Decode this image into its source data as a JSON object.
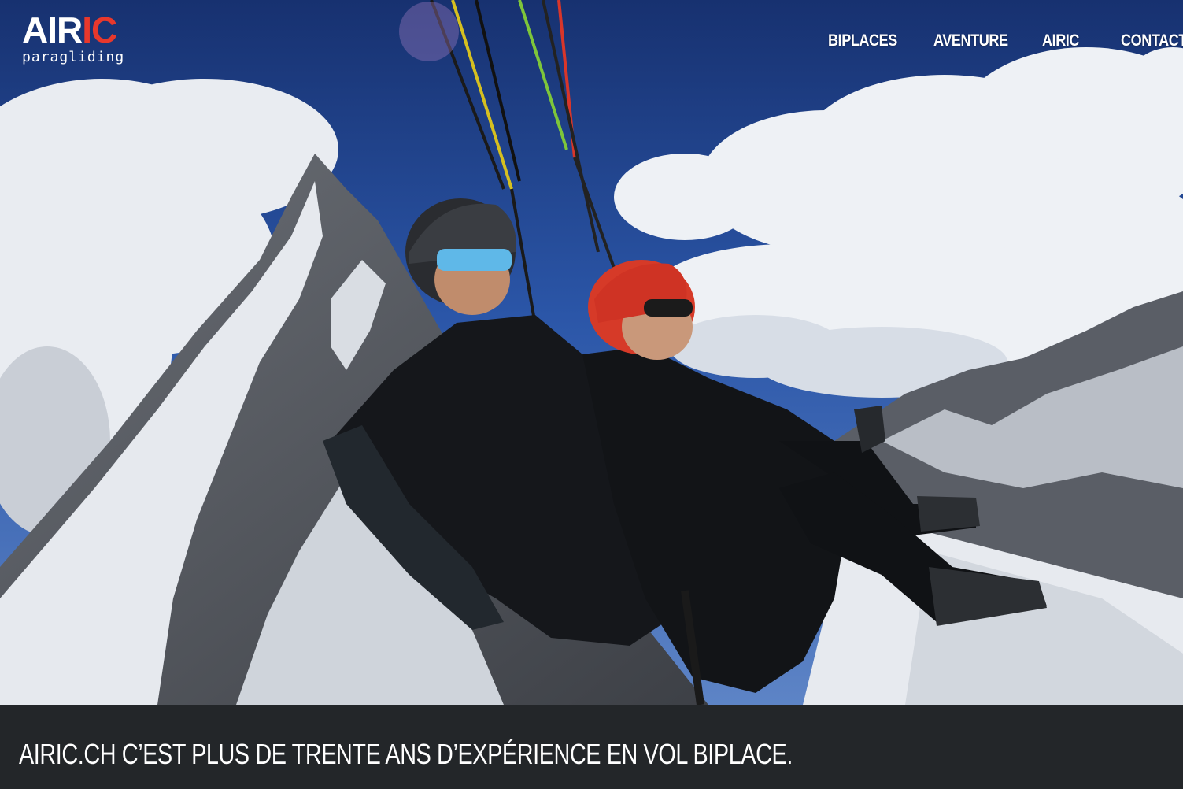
{
  "logo": {
    "part1": "AIR",
    "part2": "IC",
    "subtitle": "paragliding",
    "accent_color": "#e8382c"
  },
  "nav": {
    "items": [
      {
        "label": "BIPLACES"
      },
      {
        "label": "AVENTURE"
      },
      {
        "label": "AIRIC"
      },
      {
        "label": "CONTACT"
      }
    ]
  },
  "hero": {
    "image": "tandem-paragliding-photo"
  },
  "band": {
    "tagline": "AIRIC.CH C’EST PLUS DE TRENTE ANS D’EXPÉRIENCE EN VOL BIPLACE."
  },
  "colors": {
    "band_bg": "#232629",
    "sky": "#2a4f9c"
  }
}
